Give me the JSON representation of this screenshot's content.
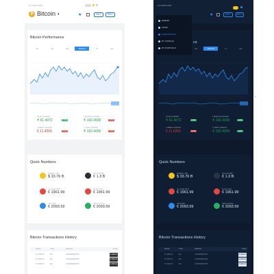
{
  "light": {
    "top_label": "DASHBOARD",
    "coin_symbol": "₿",
    "coin_name": "Bitcoin",
    "buy_label": "BUY",
    "sell_label": "SELL",
    "performance_title": "Bitcoin Performance",
    "tabs": [
      "1H",
      "1D",
      "1W",
      "MONTH",
      "1Y",
      "ALL"
    ],
    "active_tab": "MONTH",
    "stats": [
      {
        "label": "24 HR CHANGE",
        "value": "₹ 61.4072",
        "pill": "2.51%",
        "dir": "up"
      },
      {
        "label": "1 MONTH CHANGE",
        "value": "₹ 192.4000",
        "pill": "4.25%",
        "dir": "up"
      },
      {
        "label": "1 WEEK CHANGE",
        "value": "€ 11.4256",
        "pill": "2.53%",
        "dir": "down"
      },
      {
        "label": "1 YEAR CHANGE",
        "value": "₹ 192.4000",
        "pill": "4.25%",
        "dir": "up"
      }
    ],
    "quick_title": "Quick Numbers",
    "quick": [
      {
        "label": "MARKET CAP",
        "value": "$ 33.76 B",
        "color": "#f5c518"
      },
      {
        "label": "24H VOLUME",
        "value": "€ 1.3 B",
        "color": "#2a2f3a"
      },
      {
        "label": "ALL TIME HIGH",
        "value": "€ 1961.99",
        "color": "#e5483e"
      },
      {
        "label": "52 WK LOW",
        "value": "€ 1961.99",
        "color": "#e5483e"
      },
      {
        "label": "ATH DATE",
        "value": "€ 2093.59",
        "color": "#2d8cf0"
      },
      {
        "label": "CIRCULATING",
        "value": "€ 2093.59",
        "color": "#22b35e"
      }
    ],
    "tx_title": "Bitcoin Transactions History",
    "tx_headers": [
      "PRICE",
      "TYPE",
      "AMOUNT",
      "TOTAL"
    ],
    "tx_rows": [
      {
        "price": "₹ 1,0000.70",
        "type": "Sell",
        "amount": "0.1000000000 BTC",
        "total": "€ 2900.00"
      },
      {
        "price": "₹ 1,0000.70",
        "type": "Sell",
        "amount": "0.1000000000 BTC",
        "total": "€ 2900.00"
      },
      {
        "price": "₹ 1,0000.70",
        "type": "Sell",
        "amount": "0.1000000000 BTC",
        "total": "€ 2900.00"
      }
    ]
  },
  "dark": {
    "top_label": "DASHBOARD",
    "buy_label": "BUY",
    "sell_label": "SELL",
    "menu": [
      {
        "label": "MARKET",
        "active": false
      },
      {
        "label": "COINS",
        "active": false
      },
      {
        "label": "COINS DETAILS",
        "active": true
      },
      {
        "label": "MY COINS (5)",
        "active": false
      },
      {
        "label": "MY PORTFOLIO",
        "active": false
      }
    ],
    "behind_menu_text": "ce",
    "tabs": [
      "1H",
      "1D",
      "1W",
      "MONTH",
      "1Y",
      "ALL"
    ],
    "active_tab": "MONTH",
    "stats": [
      {
        "label": "24 HR CHANGE",
        "value": "₹ 61.4072",
        "pill": "2.51%",
        "dir": "up"
      },
      {
        "label": "1 MONTH CHANGE",
        "value": "₹ 192.4000",
        "pill": "4.25%",
        "dir": "up"
      },
      {
        "label": "1 WEEK CHANGE",
        "value": "€ 11.4256",
        "pill": "2.53%",
        "dir": "down"
      },
      {
        "label": "1 YEAR CHANGE",
        "value": "₹ 192.4000",
        "pill": "4.25%",
        "dir": "up"
      }
    ],
    "quick_title": "Quick Numbers",
    "quick": [
      {
        "label": "MARKET CAP",
        "value": "$ 33.76 B",
        "color": "#f5c518"
      },
      {
        "label": "24H VOLUME",
        "value": "€ 1.3 B",
        "color": "#2a3344"
      },
      {
        "label": "ALL TIME HIGH",
        "value": "€ 1961.99",
        "color": "#e5483e"
      },
      {
        "label": "52 WK LOW",
        "value": "€ 1961.99",
        "color": "#e5483e"
      },
      {
        "label": "ATH DATE",
        "value": "€ 2093.59",
        "color": "#2d8cf0"
      },
      {
        "label": "CIRCULATING",
        "value": "€ 2093.59",
        "color": "#22b35e"
      }
    ],
    "tx_title": "Bitcoin Transactions History",
    "tx_headers": [
      "PRICE",
      "TYPE",
      "AMOUNT",
      "TOTAL"
    ],
    "tx_rows": [
      {
        "price": "₹ 1,0000.70",
        "type": "Sell",
        "amount": "0.1000000000 BTC",
        "total": "€ 2900.00"
      },
      {
        "price": "₹ 1,0000.70",
        "type": "Sell",
        "amount": "0.1000000000 BTC",
        "total": "€ 2900.00"
      },
      {
        "price": "₹ 1,0000.70",
        "type": "Sell",
        "amount": "0.1000000000 BTC",
        "total": "€ 2900.00"
      }
    ]
  }
}
